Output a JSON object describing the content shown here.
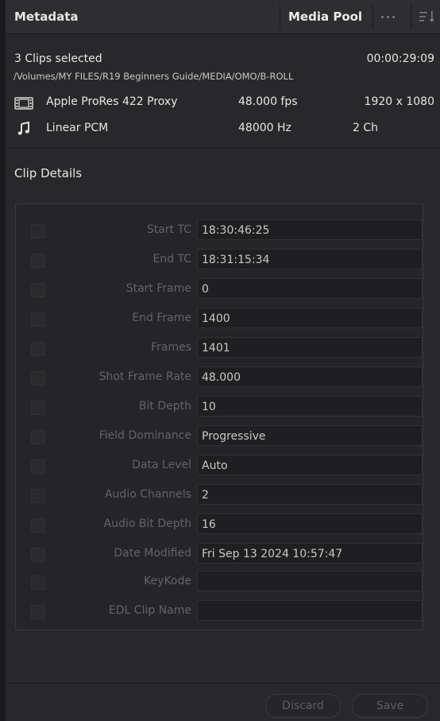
{
  "header": {
    "title": "Metadata",
    "media_pool_label": "Media Pool"
  },
  "info": {
    "clips_selected": "3 Clips selected",
    "duration": "00:00:29:09",
    "path": "/Volumes/MY FILES/R19 Beginners Guide/MEDIA/OMO/B-ROLL",
    "video": {
      "codec": "Apple ProRes 422 Proxy",
      "fps": "48.000 fps",
      "resolution": "1920 x 1080",
      "icon": "film-icon"
    },
    "audio": {
      "codec": "Linear PCM",
      "rate": "48000 Hz",
      "channels": "2 Ch",
      "icon": "music-note-icon"
    }
  },
  "clip_details": {
    "title": "Clip Details",
    "fields": [
      {
        "label": "Start TC",
        "value": "18:30:46:25"
      },
      {
        "label": "End TC",
        "value": "18:31:15:34"
      },
      {
        "label": "Start Frame",
        "value": "0"
      },
      {
        "label": "End Frame",
        "value": "1400"
      },
      {
        "label": "Frames",
        "value": "1401"
      },
      {
        "label": "Shot Frame Rate",
        "value": "48.000"
      },
      {
        "label": "Bit Depth",
        "value": "10"
      },
      {
        "label": "Field Dominance",
        "value": "Progressive"
      },
      {
        "label": "Data Level",
        "value": "Auto"
      },
      {
        "label": "Audio Channels",
        "value": "2"
      },
      {
        "label": "Audio Bit Depth",
        "value": "16"
      },
      {
        "label": "Date Modified",
        "value": "Fri Sep 13 2024 10:57:47"
      },
      {
        "label": "KeyKode",
        "value": ""
      },
      {
        "label": "EDL Clip Name",
        "value": ""
      }
    ]
  },
  "footer": {
    "discard_label": "Discard",
    "save_label": "Save"
  }
}
